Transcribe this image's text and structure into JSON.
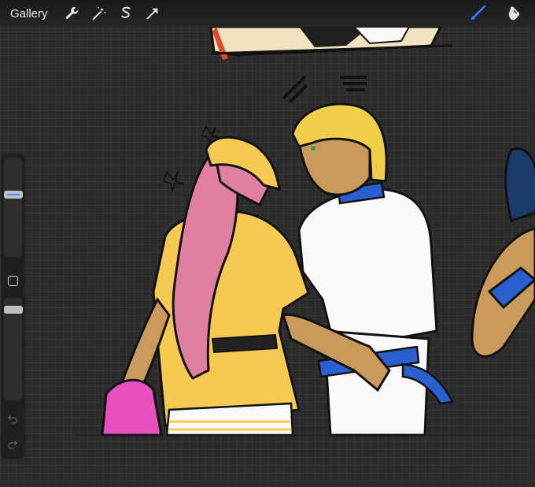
{
  "topbar": {
    "gallery_label": "Gallery",
    "tools": [
      "wrench-icon",
      "magic-wand-icon",
      "selection-icon",
      "transform-arrow-icon"
    ],
    "right_tools": [
      "brush-icon",
      "smudge-icon"
    ]
  },
  "colors": {
    "active_accent": "#3d7bff",
    "background": "#2b2b2b",
    "toolbar": "#1f1f1f"
  },
  "sidebar": {
    "controls": [
      "brush-size-slider",
      "modify-button",
      "opacity-slider",
      "undo-icon",
      "redo-icon"
    ]
  }
}
